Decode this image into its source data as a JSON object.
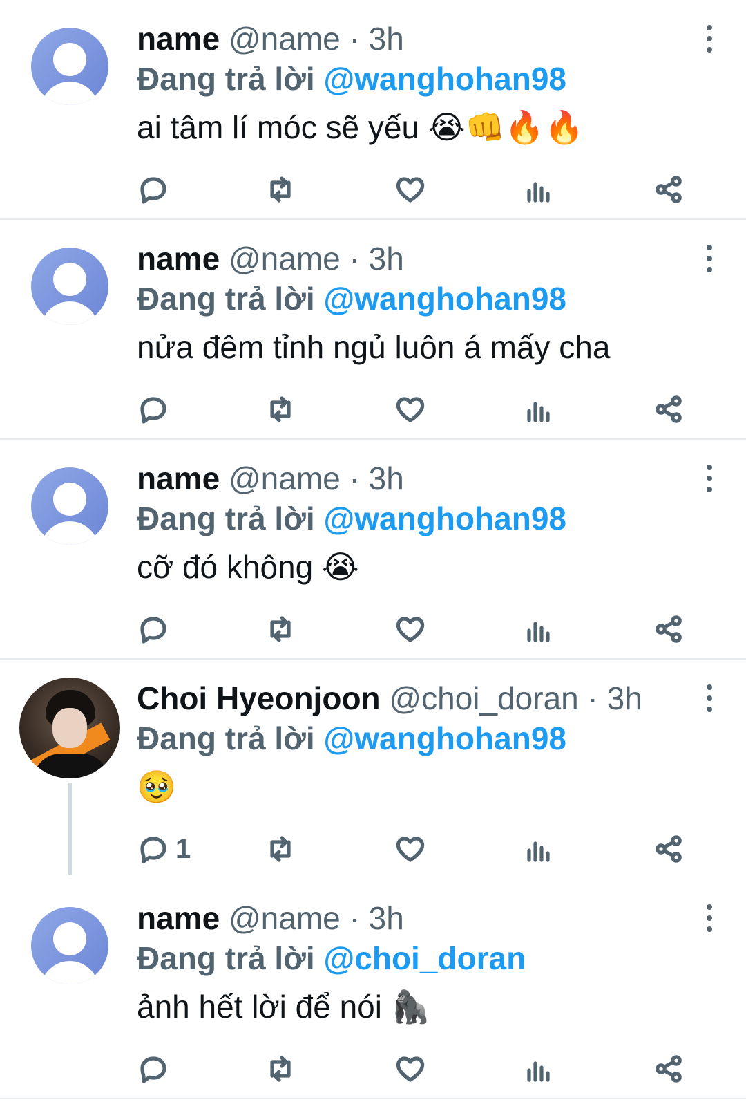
{
  "tweets": [
    {
      "display_name": "name",
      "handle": "@name",
      "separator": "·",
      "time": "3h",
      "reply_prefix": "Đang trả lời",
      "reply_to": "@wanghohan98",
      "text": "ai tâm lí móc sẽ yếu",
      "emoji": "😭👊🔥🔥",
      "reply_count": "",
      "avatar": "default-avatar"
    },
    {
      "display_name": "name",
      "handle": "@name",
      "separator": "·",
      "time": "3h",
      "reply_prefix": "Đang trả lời",
      "reply_to": "@wanghohan98",
      "text": "nửa đêm tỉnh ngủ luôn á mấy cha",
      "emoji": "",
      "reply_count": "",
      "avatar": "default-avatar"
    },
    {
      "display_name": "name",
      "handle": "@name",
      "separator": "·",
      "time": "3h",
      "reply_prefix": "Đang trả lời",
      "reply_to": "@wanghohan98",
      "text": "cỡ đó không",
      "emoji": "😭",
      "reply_count": "",
      "avatar": "default-avatar"
    },
    {
      "display_name": "Choi Hyeonjoon",
      "handle": "@choi_doran",
      "separator": "·",
      "time": "3h",
      "reply_prefix": "Đang trả lời",
      "reply_to": "@wanghohan98",
      "text": "",
      "emoji": "🥹",
      "reply_count": "1",
      "avatar": "photo-avatar"
    },
    {
      "display_name": "name",
      "handle": "@name",
      "separator": "·",
      "time": "3h",
      "reply_prefix": "Đang trả lời",
      "reply_to": "@choi_doran",
      "text": "ảnh hết lời để nói",
      "emoji": "🦍",
      "reply_count": "",
      "avatar": "default-avatar"
    }
  ],
  "icons": {
    "reply": "reply-icon",
    "retweet": "retweet-icon",
    "like": "heart-icon",
    "views": "views-icon",
    "share": "share-icon",
    "more": "more-vertical-icon"
  },
  "colors": {
    "accent": "#1d9bf0",
    "secondary_text": "#536471",
    "primary_text": "#0f1419",
    "divider": "#e8ebed",
    "default_avatar": "#7b93dd"
  }
}
